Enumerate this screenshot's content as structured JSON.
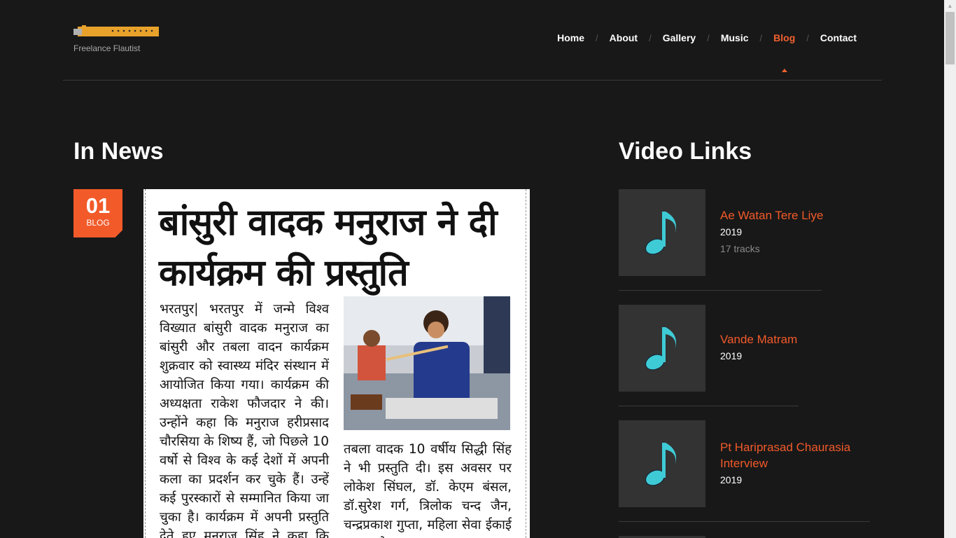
{
  "header": {
    "tagline": "Freelance Flautist",
    "nav": [
      {
        "label": "Home"
      },
      {
        "label": "About"
      },
      {
        "label": "Gallery"
      },
      {
        "label": "Music"
      },
      {
        "label": "Blog",
        "active": true
      },
      {
        "label": "Contact"
      }
    ],
    "separator": "/",
    "accent_color": "#f25a2a"
  },
  "news": {
    "heading": "In News",
    "post": {
      "day": "01",
      "label": "BLOG",
      "headline": "बांसुरी वादक मनुराज ने दी कार्यक्रम की प्रस्तुति",
      "col1": "भरतपुर| भरतपुर में जन्मे विश्व विख्यात बांसुरी वादक मनुराज का बांसुरी और तबला वादन कार्यक्रम शुक्रवार को स्वास्थ्य मंदिर संस्थान में आयोजित किया गया। कार्यक्रम की अध्यक्षता राकेश फौजदार ने की। उन्होंने कहा कि मनुराज हरीप्रसाद चौरसिया के शिष्य हैं, जो पिछले 10 वर्षो से विश्व के कई देशों में अपनी कला का प्रदर्शन कर चुके हैं। उन्हें कई पुरस्कारों से सम्मानित किया जा चुका है। कार्यक्रम में अपनी प्रस्तुति देते हुए मनुराज सिंह ने कहा कि बांसुरी शास्त्रीय संगीत गानों के",
      "col2": "तबला वादक 10 वर्षीय सिद्धी सिंह ने भी प्रस्तुति दी। इस अवसर पर लोकेश सिंघल, डॉ. केएम बंसल, डॉ.सुरेश गर्ग, त्रिलोक चन्द जैन, चन्द्रप्रकाश गुप्ता, महिला सेवा ईकाई अध्यक्ष हेमलता"
    }
  },
  "videos": {
    "heading": "Video Links",
    "items": [
      {
        "title": "Ae Watan Tere Liye",
        "year": "2019",
        "tracks": "17 tracks"
      },
      {
        "title": "Vande Matram",
        "year": "2019"
      },
      {
        "title": "Pt Hariprasad Chaurasia Interview",
        "year": "2019"
      }
    ],
    "icon": "music-note-icon",
    "icon_color": "#3ecbd6"
  }
}
